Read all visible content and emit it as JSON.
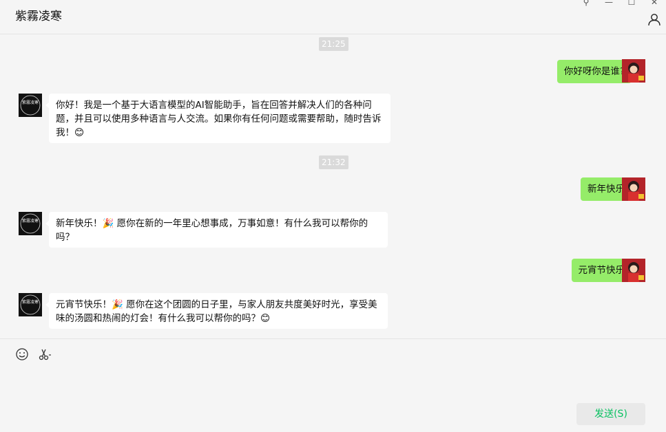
{
  "header": {
    "title": "紫霧凌寒",
    "window_controls": {
      "pin_glyph": "⚲",
      "min_glyph": "—",
      "max_glyph": "☐",
      "close_glyph": "✕"
    }
  },
  "bot": {
    "avatar_text": "紫霧凌寒"
  },
  "messages": [
    {
      "type": "time",
      "text": "21:25"
    },
    {
      "type": "me",
      "text": "你好呀你是谁?"
    },
    {
      "type": "bot",
      "text": "你好！我是一个基于大语言模型的AI智能助手，旨在回答并解决人们的各种问题，并且可以使用多种语言与人交流。如果你有任何问题或需要帮助，随时告诉我！😊"
    },
    {
      "type": "time",
      "text": "21:32"
    },
    {
      "type": "me",
      "text": "新年快乐"
    },
    {
      "type": "bot",
      "text": "新年快乐！🎉 愿你在新的一年里心想事成，万事如意！有什么我可以帮你的吗？"
    },
    {
      "type": "me",
      "text": "元宵节快乐"
    },
    {
      "type": "bot",
      "text": "元宵节快乐！🎉 愿你在这个团圆的日子里，与家人朋友共度美好时光，享受美味的汤圆和热闹的灯会！有什么我可以帮你的吗？😊"
    }
  ],
  "toolbar": {
    "icons": [
      "emoji-icon",
      "scissors-icon"
    ]
  },
  "send_button": {
    "label": "发送(S)"
  },
  "colors": {
    "accent": "#07c160",
    "my_bubble": "#95ec69",
    "bot_bubble": "#ffffff"
  }
}
